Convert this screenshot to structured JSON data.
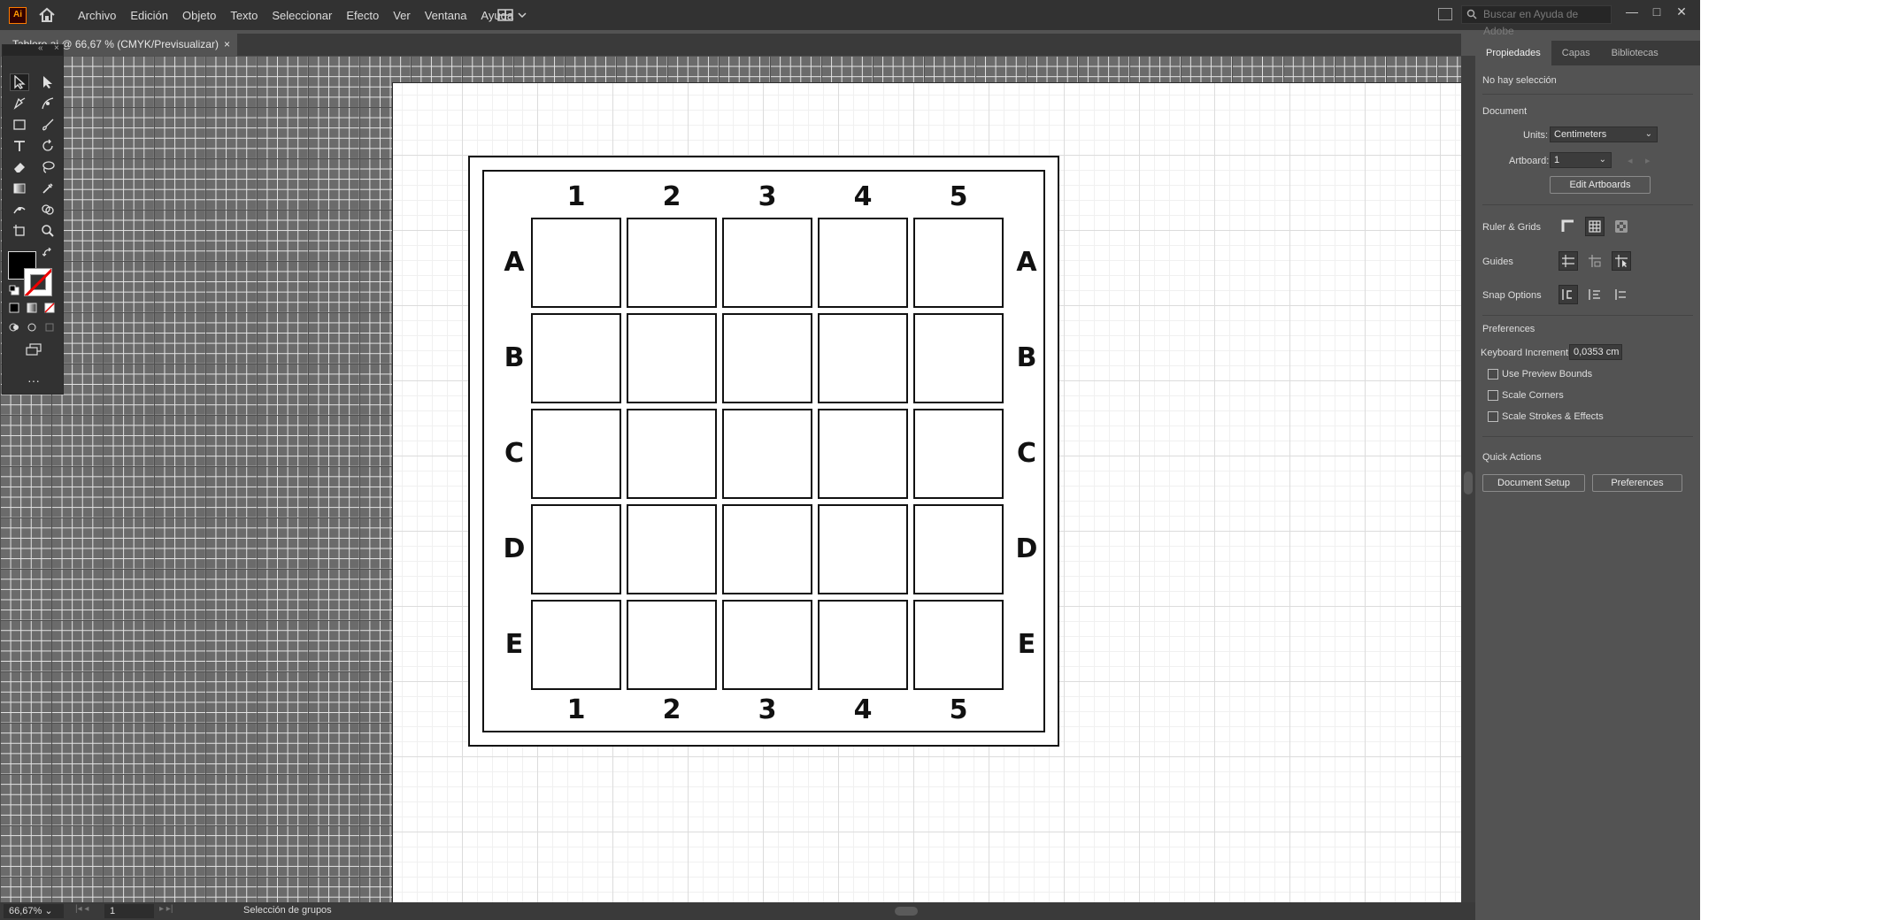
{
  "app": {
    "logo_text": "Ai",
    "menu": [
      "Archivo",
      "Edición",
      "Objeto",
      "Texto",
      "Seleccionar",
      "Efecto",
      "Ver",
      "Ventana",
      "Ayuda"
    ],
    "search_placeholder": "Buscar en Ayuda de Adobe",
    "window_buttons": [
      "—",
      "□",
      "✕"
    ]
  },
  "document_tab": {
    "title": "Tablero ai @ 66,67 % (CMYK/Previsualizar)",
    "close": "×"
  },
  "board": {
    "columns": [
      "1",
      "2",
      "3",
      "4",
      "5"
    ],
    "rows": [
      "A",
      "B",
      "C",
      "D",
      "E"
    ]
  },
  "properties_panel": {
    "tabs": [
      "Propiedades",
      "Capas",
      "Bibliotecas"
    ],
    "selection_status": "No hay selección",
    "document_heading": "Document",
    "units_label": "Units:",
    "units_value": "Centimeters",
    "artboard_label": "Artboard:",
    "artboard_value": "1",
    "edit_artboards": "Edit Artboards",
    "ruler_grids_label": "Ruler & Grids",
    "guides_label": "Guides",
    "snap_options_label": "Snap Options",
    "preferences_heading": "Preferences",
    "keyboard_increment_label": "Keyboard Increment:",
    "keyboard_increment_value": "0,0353 cm",
    "checkboxes": [
      "Use Preview Bounds",
      "Scale Corners",
      "Scale Strokes & Effects"
    ],
    "quick_actions_heading": "Quick Actions",
    "document_setup": "Document Setup",
    "preferences_button": "Preferences"
  },
  "status_bar": {
    "zoom": "66,67%",
    "page": "1",
    "status": "Selección de grupos"
  },
  "colors": {
    "chrome_dark": "#323232",
    "panel": "#535353",
    "accent_orange": "#ff7c00"
  }
}
